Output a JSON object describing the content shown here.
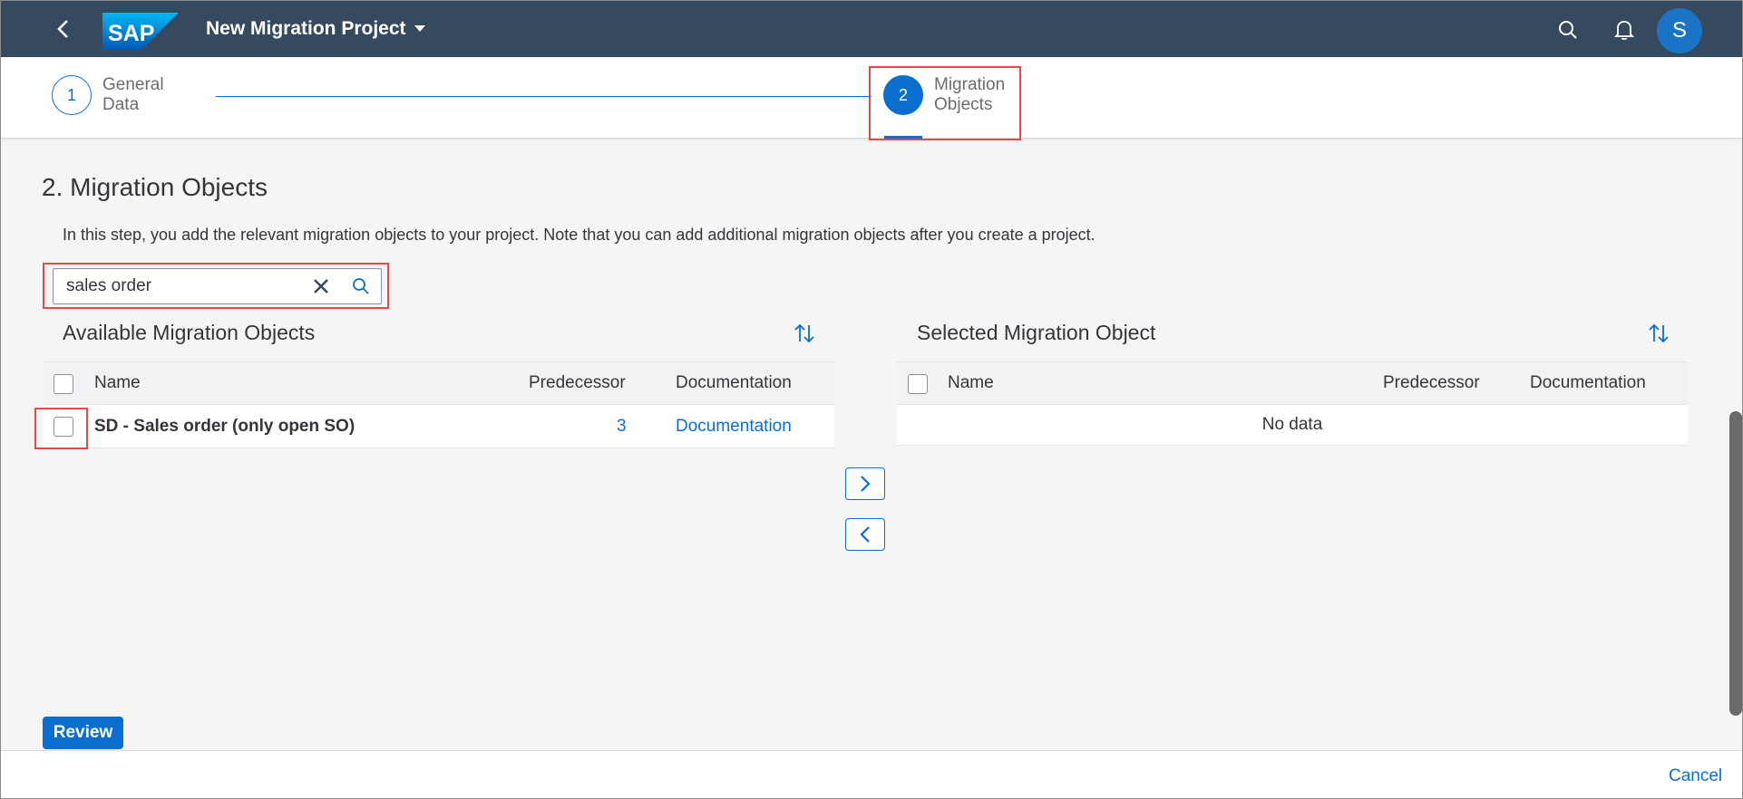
{
  "shell": {
    "title": "New Migration Project",
    "logo_text": "SAP",
    "avatar_initial": "S",
    "icons": {
      "back": "back-chevron-icon",
      "search": "search-icon",
      "notifications": "bell-icon"
    }
  },
  "wizard": {
    "steps": [
      {
        "number": "1",
        "label_line1": "General",
        "label_line2": "Data"
      },
      {
        "number": "2",
        "label_line1": "Migration",
        "label_line2": "Objects"
      }
    ]
  },
  "main": {
    "title": "2. Migration Objects",
    "description": "In this step, you add the relevant migration objects to your project. Note that you can add additional migration objects after you create a project.",
    "search": {
      "value": "sales order"
    }
  },
  "available": {
    "title": "Available Migration Objects",
    "columns": {
      "name": "Name",
      "predecessor": "Predecessor",
      "documentation": "Documentation"
    },
    "rows": [
      {
        "name": "SD - Sales order (only open SO)",
        "predecessor": "3",
        "documentation": "Documentation"
      }
    ]
  },
  "selected": {
    "title": "Selected Migration Object",
    "columns": {
      "name": "Name",
      "predecessor": "Predecessor",
      "documentation": "Documentation"
    },
    "empty_text": "No data"
  },
  "footer": {
    "review_label": "Review",
    "cancel_label": "Cancel"
  },
  "colors": {
    "shell": "#354a5f",
    "accent": "#0a6ed1",
    "highlight": "#e34a4a"
  }
}
